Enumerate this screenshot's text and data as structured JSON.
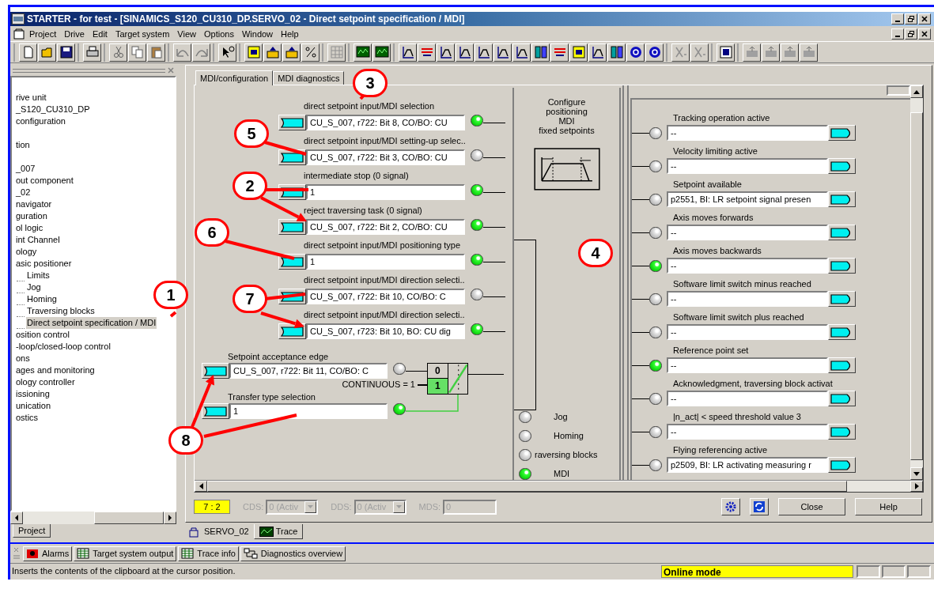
{
  "window": {
    "title": "STARTER - for test - [SINAMICS_S120_CU310_DP.SERVO_02 - Direct setpoint specification / MDI]"
  },
  "menu": [
    "Project",
    "Drive",
    "Edit",
    "Target system",
    "View",
    "Options",
    "Window",
    "Help"
  ],
  "project_tree": {
    "tab": "Project",
    "items": [
      {
        "label": "rive unit",
        "selected": false
      },
      {
        "label": "_S120_CU310_DP",
        "selected": false
      },
      {
        "label": "configuration",
        "selected": false
      },
      {
        "label": "tion",
        "selected": false,
        "gap_before": true
      },
      {
        "label": "_007",
        "selected": false,
        "gap_before": true
      },
      {
        "label": "out component",
        "selected": false
      },
      {
        "label": "_02",
        "selected": false
      },
      {
        "label": "navigator",
        "selected": false
      },
      {
        "label": "guration",
        "selected": false
      },
      {
        "label": "ol logic",
        "selected": false
      },
      {
        "label": "int Channel",
        "selected": false
      },
      {
        "label": "ology",
        "selected": false
      },
      {
        "label": "asic positioner",
        "selected": false,
        "children": [
          {
            "label": "Limits",
            "selected": false
          },
          {
            "label": "Jog",
            "selected": false
          },
          {
            "label": "Homing",
            "selected": false
          },
          {
            "label": "Traversing blocks",
            "selected": false
          },
          {
            "label": "Direct setpoint specification / MDI",
            "selected": true
          }
        ]
      },
      {
        "label": "osition control",
        "selected": false
      },
      {
        "label": "-loop/closed-loop control",
        "selected": false
      },
      {
        "label": "ons",
        "selected": false
      },
      {
        "label": "ages and monitoring",
        "selected": false
      },
      {
        "label": "ology controller",
        "selected": false
      },
      {
        "label": "issioning",
        "selected": false
      },
      {
        "label": "unication",
        "selected": false
      },
      {
        "label": "ostics",
        "selected": false
      }
    ]
  },
  "editor": {
    "tabs": [
      {
        "label": "MDI/configuration",
        "selected": true
      },
      {
        "label": "MDI diagnostics",
        "selected": false
      }
    ],
    "inputs": [
      {
        "label": "direct setpoint input/MDI selection",
        "value": "CU_S_007, r722: Bit 8, CO/BO: CU",
        "on": true
      },
      {
        "label": "direct setpoint input/MDI setting-up selec..",
        "value": "CU_S_007, r722: Bit 3, CO/BO: CU",
        "on": false
      },
      {
        "label": "intermediate stop (0 signal)",
        "value": "1",
        "on": true
      },
      {
        "label": "reject traversing task (0 signal)",
        "value": "CU_S_007, r722: Bit 2, CO/BO: CU",
        "on": true
      },
      {
        "label": "direct setpoint input/MDI positioning type",
        "value": "1",
        "on": true
      },
      {
        "label": "direct setpoint input/MDI direction selecti..",
        "value": "CU_S_007, r722: Bit 10, CO/BO: C",
        "on": false
      },
      {
        "label": "direct setpoint input/MDI direction selecti..",
        "value": "CU_S_007, r723: Bit 10, BO: CU dig",
        "on": true
      }
    ],
    "setpoint_acceptance_edge": {
      "label": "Setpoint acceptance edge",
      "value": "CU_S_007, r722: Bit 11, CO/BO: C",
      "on": false
    },
    "transfer_type": {
      "label": "Transfer type selection",
      "value": "1",
      "on": true
    },
    "switch": {
      "caption": "CONTINUOUS = 1",
      "options": [
        {
          "label": "0",
          "selected": false
        },
        {
          "label": "1",
          "selected": true
        }
      ]
    },
    "configure_button": [
      "Configure",
      "positioning",
      "MDI",
      "fixed setpoints"
    ],
    "modes": [
      {
        "label": "Jog",
        "on": false
      },
      {
        "label": "Homing",
        "on": false
      },
      {
        "label": "raversing blocks",
        "on": false
      },
      {
        "label": "MDI",
        "on": true
      }
    ],
    "outputs": [
      {
        "label": "Tracking operation active",
        "value": "--",
        "on": false
      },
      {
        "label": "Velocity limiting active",
        "value": "--",
        "on": false
      },
      {
        "label": "Setpoint available",
        "value": "p2551, BI: LR setpoint signal presen",
        "on": false
      },
      {
        "label": "Axis moves forwards",
        "value": "--",
        "on": false
      },
      {
        "label": "Axis moves backwards",
        "value": "--",
        "on": true
      },
      {
        "label": "Software limit switch minus reached",
        "value": "--",
        "on": false
      },
      {
        "label": "Software limit switch plus reached",
        "value": "--",
        "on": false
      },
      {
        "label": "Reference point set",
        "value": "--",
        "on": true
      },
      {
        "label": "Acknowledgment, traversing block activat",
        "value": "--",
        "on": false
      },
      {
        "label": "|n_act| < speed threshold value 3",
        "value": "--",
        "on": false
      },
      {
        "label": "Flying referencing active",
        "value": "p2509, BI: LR activating measuring r",
        "on": false
      }
    ]
  },
  "footer": {
    "index": "7 : 2",
    "cds": {
      "label": "CDS:",
      "value": "0 (Activ",
      "disabled": true
    },
    "dds": {
      "label": "DDS:",
      "value": "0 (Activ",
      "disabled": true
    },
    "mds": {
      "label": "MDS:",
      "value": "0",
      "disabled": true
    },
    "buttons": [
      "Close",
      "Help"
    ]
  },
  "document_tabs": [
    {
      "label": "SERVO_02",
      "selected": true
    },
    {
      "label": "Trace",
      "selected": false
    }
  ],
  "output_tabs": [
    "Alarms",
    "Target system output",
    "Trace info",
    "Diagnostics overview"
  ],
  "status_bar": {
    "message": "Inserts the contents of the clipboard at the cursor position.",
    "mode": "Online mode"
  },
  "callouts": [
    "3",
    "5",
    "2",
    "6",
    "7",
    "1",
    "4",
    "8"
  ]
}
